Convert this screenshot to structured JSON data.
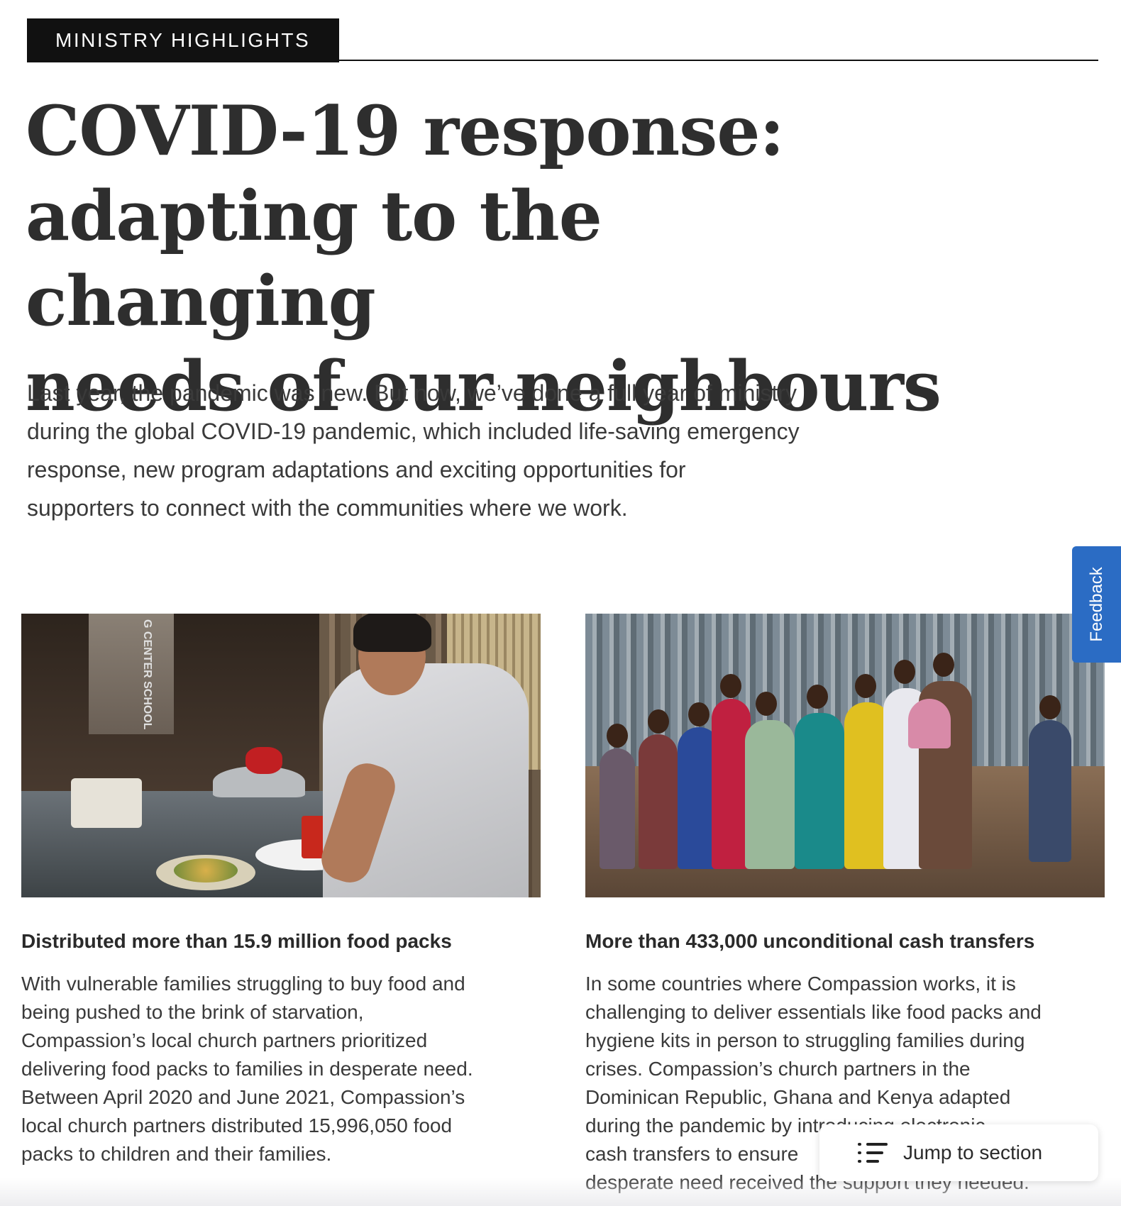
{
  "section_label": "MINISTRY HIGHLIGHTS",
  "title_lines": [
    "COVID-19 response:",
    "adapting to the changing",
    "needs of our neighbours"
  ],
  "intro_lines": [
    "Last year, the pandemic was new. But now, we’ve done a full year of ministry",
    "during the global COVID-19 pandemic, which included life-saving emergency",
    "response, new program adaptations and exciting opportunities for",
    "supporters to connect with the communities where we work."
  ],
  "cards": [
    {
      "heading": "Distributed more than 15.9 million food packs",
      "body_lines": [
        "With vulnerable families struggling to buy food and",
        "being pushed to the brink of starvation,",
        "Compassion’s local church partners prioritized",
        "delivering food packs to families in desperate need.",
        "Between April 2020 and June 2021, Compassion’s",
        "local church partners distributed 15,996,050 food",
        "packs to children and their families."
      ],
      "photo_sign_text": "G CENTER SCHOOL"
    },
    {
      "heading": "More than 433,000 unconditional cash transfers",
      "body_lines": [
        "In some countries where Compassion works, it is",
        "challenging to deliver essentials like food packs and",
        "hygiene kits in person to struggling families during",
        "crises. Compassion’s church partners in the",
        "Dominican Republic, Ghana and Kenya adapted",
        "during the pandemic by introducing electronic",
        "cash transfers to ensure",
        "desperate need received the support they needed."
      ]
    }
  ],
  "feedback_label": "Feedback",
  "jump_label": "Jump to section",
  "colors": {
    "label_bg": "#111111",
    "feedback_bg": "#2b6cc4",
    "title": "#2e2e2e"
  },
  "icons": [
    "list-icon"
  ]
}
